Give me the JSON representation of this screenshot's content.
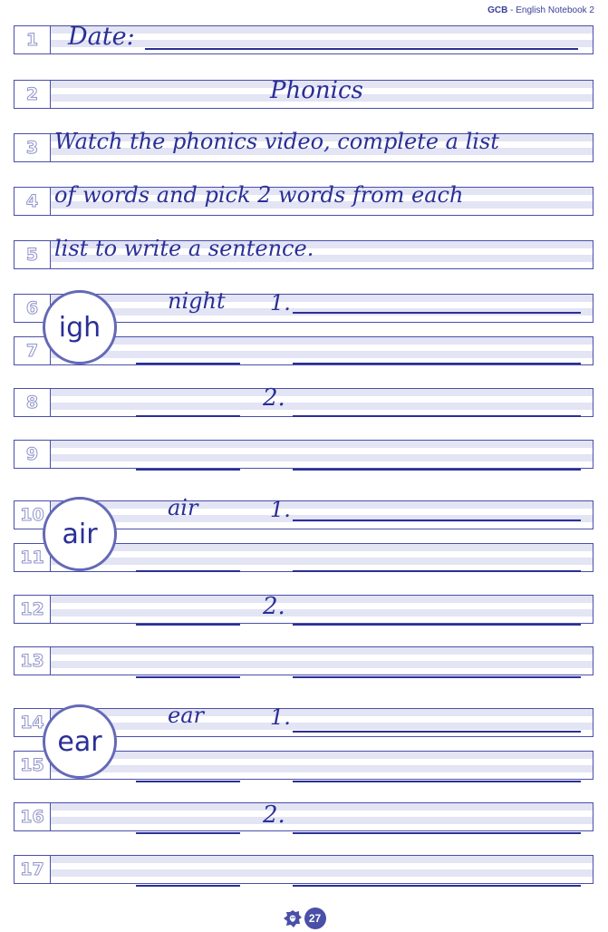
{
  "header": {
    "brand": "GCB",
    "separator": " - ",
    "title": "English Notebook 2"
  },
  "row_numbers": [
    "1",
    "2",
    "3",
    "4",
    "5",
    "6",
    "7",
    "8",
    "9",
    "10",
    "11",
    "12",
    "13",
    "14",
    "15",
    "16",
    "17"
  ],
  "handwriting": {
    "date_label": "Date:",
    "heading": "Phonics",
    "instruction_line_1": "Watch the phonics video, complete a list",
    "instruction_line_2": "of words and pick 2 words from each",
    "instruction_line_3": "list to write a sentence."
  },
  "phonics_groups": [
    {
      "sound": "igh",
      "example_word": "night",
      "marker_1": "1.",
      "marker_2": "2."
    },
    {
      "sound": "air",
      "example_word": "air",
      "marker_1": "1.",
      "marker_2": "2."
    },
    {
      "sound": "ear",
      "example_word": "ear",
      "marker_1": "1.",
      "marker_2": "2."
    }
  ],
  "footer": {
    "page_number": "27",
    "logo_icon": "lion-head-icon"
  },
  "colors": {
    "ink": "#2a2f96",
    "border": "#4a4fa8",
    "band": "#e3e4f4",
    "circle": "#6469b7"
  }
}
